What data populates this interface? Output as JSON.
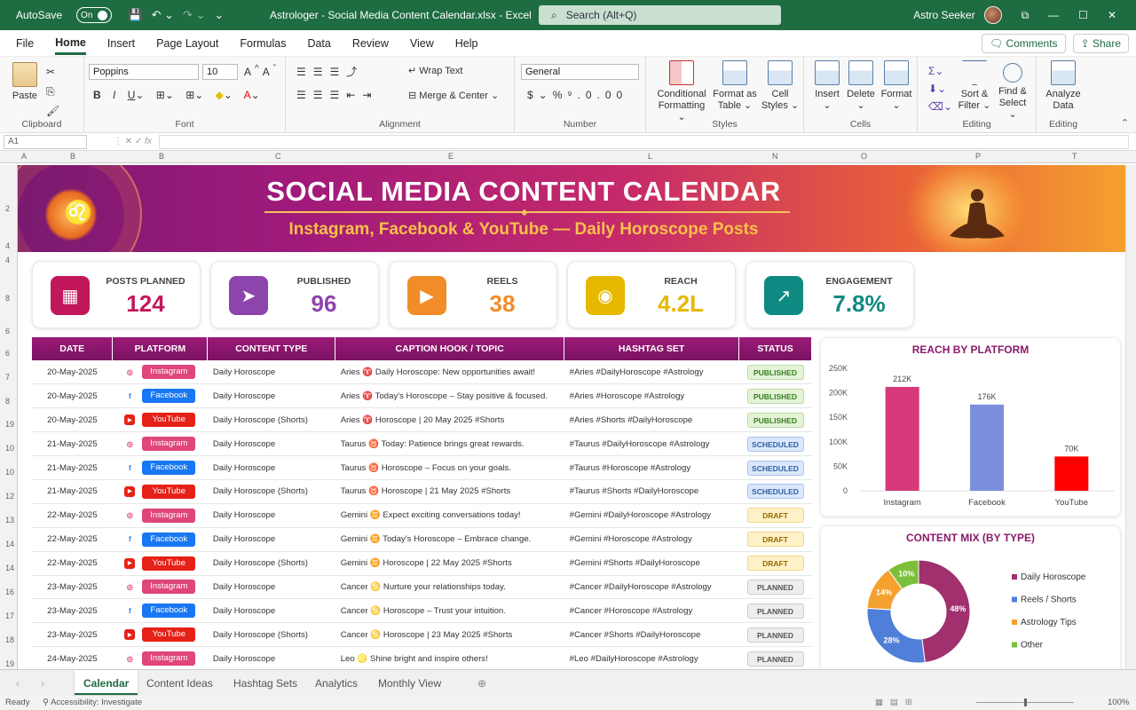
{
  "titlebar": {
    "autosave_label": "AutoSave",
    "autosave_state": "On",
    "file_title": "Astrologer - Social Media Content Calendar.xlsx",
    "app_name": "Excel",
    "search_placeholder": "Search (Alt+Q)",
    "user_name": "Astro Seeker"
  },
  "menu": {
    "items": [
      "File",
      "Home",
      "Insert",
      "Page Layout",
      "Formulas",
      "Data",
      "Review",
      "View",
      "Help"
    ],
    "active": "Home",
    "comments": "Comments",
    "share": "Share"
  },
  "ribbon": {
    "clipboard": {
      "paste": "Paste",
      "label": "Clipboard"
    },
    "font": {
      "name": "Poppins",
      "size": "10",
      "label": "Font"
    },
    "alignment": {
      "wrap": "Wrap Text",
      "merge": "Merge & Center",
      "label": "Alignment"
    },
    "number": {
      "format": "General",
      "label": "Number"
    },
    "styles": {
      "conditional": "Conditional",
      "conditional2": "Formatting",
      "format_table": "Format as",
      "format_table2": "Table",
      "cell_styles": "Cell",
      "cell_styles2": "Styles",
      "label": "Styles"
    },
    "cells": {
      "insert": "Insert",
      "delete": "Delete",
      "format": "Format",
      "label": "Cells"
    },
    "editing": {
      "sort": "Sort &",
      "sort2": "Filter",
      "find": "Find &",
      "find2": "Select",
      "label": "Editing"
    },
    "analyze": {
      "btn": "Analyze",
      "btn2": "Data",
      "label": "Editing"
    }
  },
  "formula_bar": {
    "name_box": "A1"
  },
  "banner": {
    "title": "SOCIAL MEDIA CONTENT CALENDAR",
    "subtitle": "Instagram, Facebook & YouTube — Daily Horoscope Posts"
  },
  "kpis": [
    {
      "label": "POSTS PLANNED",
      "value": "124",
      "color": "#c2185b",
      "icon": "calendar-icon"
    },
    {
      "label": "PUBLISHED",
      "value": "96",
      "color": "#8e44ad",
      "icon": "send-icon"
    },
    {
      "label": "REELS",
      "value": "38",
      "color": "#f28c28",
      "icon": "reel-icon"
    },
    {
      "label": "REACH",
      "value": "4.2L",
      "color": "#e6b800",
      "icon": "eye-icon"
    },
    {
      "label": "ENGAGEMENT",
      "value": "7.8%",
      "color": "#0e8a82",
      "icon": "trend-icon"
    }
  ],
  "table": {
    "headers": [
      "DATE",
      "PLATFORM",
      "CONTENT TYPE",
      "CAPTION HOOK / TOPIC",
      "HASHTAG SET",
      "STATUS"
    ],
    "rows": [
      {
        "date": "20-May-2025",
        "platform": "Instagram",
        "type": "Daily Horoscope",
        "caption": "Aries ♈ Daily Horoscope: New opportunities await!",
        "hashtags": "#Aries #DailyHoroscope #Astrology",
        "status": "PUBLISHED"
      },
      {
        "date": "20-May-2025",
        "platform": "Facebook",
        "type": "Daily Horoscope",
        "caption": "Aries ♈ Today's Horoscope – Stay positive & focused.",
        "hashtags": "#Aries #Horoscope #Astrology",
        "status": "PUBLISHED"
      },
      {
        "date": "20-May-2025",
        "platform": "YouTube",
        "type": "Daily Horoscope (Shorts)",
        "caption": "Aries ♈ Horoscope | 20 May 2025 #Shorts",
        "hashtags": "#Aries #Shorts #DailyHoroscope",
        "status": "PUBLISHED"
      },
      {
        "date": "21-May-2025",
        "platform": "Instagram",
        "type": "Daily Horoscope",
        "caption": "Taurus ♉ Today: Patience brings great rewards.",
        "hashtags": "#Taurus #DailyHoroscope #Astrology",
        "status": "SCHEDULED"
      },
      {
        "date": "21-May-2025",
        "platform": "Facebook",
        "type": "Daily Horoscope",
        "caption": "Taurus ♉ Horoscope – Focus on your goals.",
        "hashtags": "#Taurus #Horoscope #Astrology",
        "status": "SCHEDULED"
      },
      {
        "date": "21-May-2025",
        "platform": "YouTube",
        "type": "Daily Horoscope (Shorts)",
        "caption": "Taurus ♉ Horoscope | 21 May 2025 #Shorts",
        "hashtags": "#Taurus #Shorts #DailyHoroscope",
        "status": "SCHEDULED"
      },
      {
        "date": "22-May-2025",
        "platform": "Instagram",
        "type": "Daily Horoscope",
        "caption": "Gemini ♊ Expect exciting conversations today!",
        "hashtags": "#Gemini #DailyHoroscope #Astrology",
        "status": "DRAFT"
      },
      {
        "date": "22-May-2025",
        "platform": "Facebook",
        "type": "Daily Horoscope",
        "caption": "Gemini ♊ Today's Horoscope – Embrace change.",
        "hashtags": "#Gemini #Horoscope #Astrology",
        "status": "DRAFT"
      },
      {
        "date": "22-May-2025",
        "platform": "YouTube",
        "type": "Daily Horoscope (Shorts)",
        "caption": "Gemini ♊ Horoscope | 22 May 2025 #Shorts",
        "hashtags": "#Gemini #Shorts #DailyHoroscope",
        "status": "DRAFT"
      },
      {
        "date": "23-May-2025",
        "platform": "Instagram",
        "type": "Daily Horoscope",
        "caption": "Cancer ♋ Nurture your relationships today.",
        "hashtags": "#Cancer #DailyHoroscope #Astrology",
        "status": "PLANNED"
      },
      {
        "date": "23-May-2025",
        "platform": "Facebook",
        "type": "Daily Horoscope",
        "caption": "Cancer ♋ Horoscope – Trust your intuition.",
        "hashtags": "#Cancer #Horoscope #Astrology",
        "status": "PLANNED"
      },
      {
        "date": "23-May-2025",
        "platform": "YouTube",
        "type": "Daily Horoscope (Shorts)",
        "caption": "Cancer ♋ Horoscope | 23 May 2025 #Shorts",
        "hashtags": "#Cancer #Shorts #DailyHoroscope",
        "status": "PLANNED"
      },
      {
        "date": "24-May-2025",
        "platform": "Instagram",
        "type": "Daily Horoscope",
        "caption": "Leo ♌ Shine bright and inspire others!",
        "hashtags": "#Leo #DailyHoroscope #Astrology",
        "status": "PLANNED"
      }
    ]
  },
  "platform_colors": {
    "Instagram": "#e0457b",
    "Facebook": "#1877f2",
    "YouTube": "#e62117"
  },
  "status_colors": {
    "PUBLISHED": {
      "bg": "#e3f4d6",
      "fg": "#3a7d22",
      "bd": "#b8dca0"
    },
    "SCHEDULED": {
      "bg": "#dbe8fb",
      "fg": "#2f5fa8",
      "bd": "#a8c4ee"
    },
    "DRAFT": {
      "bg": "#fdf1c7",
      "fg": "#9a6a00",
      "bd": "#f0d88a"
    },
    "PLANNED": {
      "bg": "#eeeeee",
      "fg": "#555555",
      "bd": "#cccccc"
    }
  },
  "chart_data": [
    {
      "type": "bar",
      "title": "REACH BY PLATFORM",
      "categories": [
        "Instagram",
        "Facebook",
        "YouTube"
      ],
      "values": [
        212,
        176,
        70
      ],
      "data_labels": [
        "212K",
        "176K",
        "70K"
      ],
      "colors": [
        "#d63a7a",
        "#7b8fdc",
        "#ff0000"
      ],
      "ylim": [
        0,
        250
      ],
      "yticks": [
        "0",
        "50K",
        "100K",
        "150K",
        "200K",
        "250K"
      ],
      "grid": false
    },
    {
      "type": "pie",
      "title": "CONTENT MIX (BY TYPE)",
      "categories": [
        "Daily Horoscope",
        "Reels / Shorts",
        "Astrology Tips",
        "Other"
      ],
      "values": [
        48,
        28,
        14,
        10
      ],
      "labels": [
        "48%",
        "28%",
        "14%",
        "10%"
      ],
      "colors": [
        "#a0306e",
        "#4f7fd8",
        "#f4a130",
        "#7cbf3a"
      ],
      "legend": "right"
    }
  ],
  "sheet_tabs": [
    "Calendar",
    "Content Ideas",
    "Hashtag Sets",
    "Analytics",
    "Monthly View"
  ],
  "active_tab": "Calendar",
  "status_bar": {
    "ready": "Ready",
    "accessibility": "Accessibility: Investigate",
    "zoom": "100%"
  },
  "col_letters": [
    "A",
    "B",
    "B",
    "C",
    "E",
    "L",
    "N",
    "O",
    "P",
    "T"
  ],
  "row_numbers": [
    "2",
    "4",
    "4",
    "8",
    "6",
    "6",
    "7",
    "8",
    "19",
    "10",
    "10",
    "12",
    "13",
    "14",
    "14",
    "16",
    "17",
    "18",
    "19"
  ]
}
